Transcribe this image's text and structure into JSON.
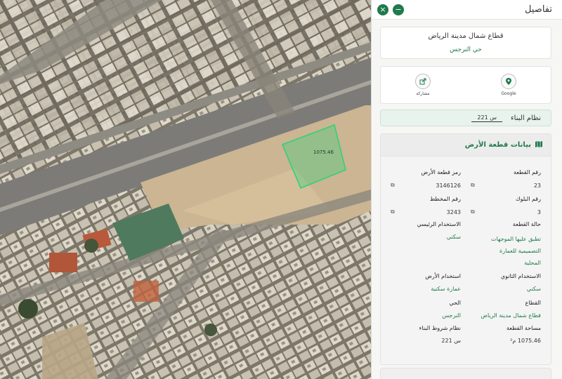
{
  "panel": {
    "title": "تفاصيل",
    "close_symbol": "×",
    "minimize_symbol": "−",
    "icons": {
      "close": "close-icon",
      "minimize": "minus-icon",
      "google": "google-maps-icon",
      "share": "share-icon",
      "copy": "copy-icon",
      "map": "map-icon"
    }
  },
  "area": {
    "sector": "قطاع شمال مدينة الرياض",
    "district": "حي النرجس"
  },
  "actions": {
    "google_label": "Google",
    "share_label": "مشاركة"
  },
  "building_system": {
    "label": "نظام البناء",
    "value": "س 221"
  },
  "land_info": {
    "title": "بيانات قطعة الأرض",
    "plot_number_label": "رقم القطعة",
    "plot_number": "23",
    "land_code_label": "رمز قطعة الأرض",
    "land_code": "3146126",
    "block_number_label": "رقم البلوك",
    "block_number": "3",
    "plan_number_label": "رقم المخطط",
    "plan_number": "3243",
    "plot_status_label": "حالة القطعة",
    "plot_status_lines": [
      "تطبق عليها الموجهات",
      "التصميمية للعمارة",
      "المحلية"
    ],
    "main_use_label": "الاستخدام الرئيسي",
    "main_use": "سكني",
    "secondary_use_label": "الاستخدام الثانوي",
    "secondary_use": "سكني",
    "land_use_label": "استخدام الأرض",
    "land_use": "عمارة سكنية",
    "sector_label": "القطاع",
    "sector": "قطاع شمال مدينة الرياض",
    "district_label": "الحي",
    "district": "النرجس",
    "area_label": "مساحة القطعة",
    "area": "1075.46 م²",
    "conditions_label": "نظام شروط البناء",
    "conditions": "س 221"
  },
  "map": {
    "plot_area_label": "1075.46",
    "plot_color": "#2fd07a"
  }
}
